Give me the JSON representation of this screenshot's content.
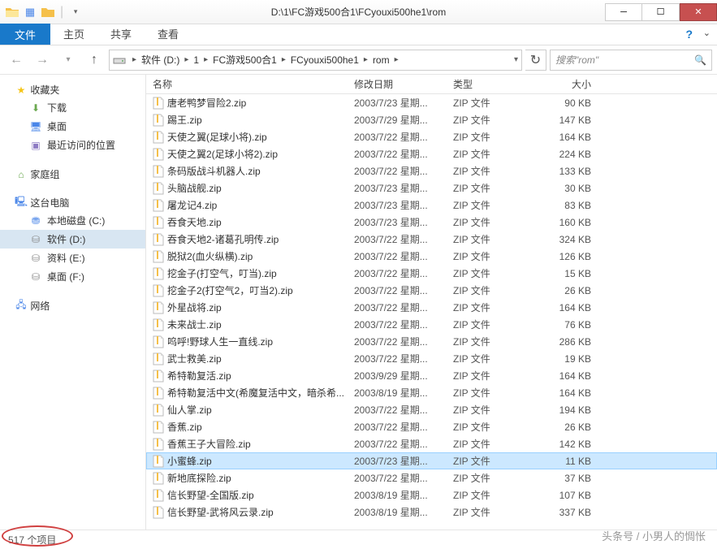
{
  "window": {
    "title": "D:\\1\\FC游戏500合1\\FCyouxi500he1\\rom"
  },
  "ribbon": {
    "file": "文件",
    "tabs": [
      "主页",
      "共享",
      "查看"
    ]
  },
  "breadcrumb": {
    "items": [
      "软件 (D:)",
      "1",
      "FC游戏500合1",
      "FCyouxi500he1",
      "rom"
    ]
  },
  "search": {
    "placeholder": "搜索\"rom\""
  },
  "sidebar": {
    "favorites": {
      "label": "收藏夹",
      "items": [
        "下载",
        "桌面",
        "最近访问的位置"
      ]
    },
    "homegroup": {
      "label": "家庭组"
    },
    "computer": {
      "label": "这台电脑",
      "items": [
        "本地磁盘 (C:)",
        "软件 (D:)",
        "资料 (E:)",
        "桌面 (F:)"
      ]
    },
    "network": {
      "label": "网络"
    }
  },
  "columns": {
    "name": "名称",
    "date": "修改日期",
    "type": "类型",
    "size": "大小"
  },
  "files": [
    {
      "name": "唐老鸭梦冒险2.zip",
      "date": "2003/7/23 星期...",
      "type": "ZIP 文件",
      "size": "90 KB"
    },
    {
      "name": "踢王.zip",
      "date": "2003/7/29 星期...",
      "type": "ZIP 文件",
      "size": "147 KB"
    },
    {
      "name": "天使之翼(足球小将).zip",
      "date": "2003/7/22 星期...",
      "type": "ZIP 文件",
      "size": "164 KB"
    },
    {
      "name": "天使之翼2(足球小将2).zip",
      "date": "2003/7/22 星期...",
      "type": "ZIP 文件",
      "size": "224 KB"
    },
    {
      "name": "条码版战斗机器人.zip",
      "date": "2003/7/22 星期...",
      "type": "ZIP 文件",
      "size": "133 KB"
    },
    {
      "name": "头脑战舰.zip",
      "date": "2003/7/23 星期...",
      "type": "ZIP 文件",
      "size": "30 KB"
    },
    {
      "name": "屠龙记4.zip",
      "date": "2003/7/23 星期...",
      "type": "ZIP 文件",
      "size": "83 KB"
    },
    {
      "name": "吞食天地.zip",
      "date": "2003/7/23 星期...",
      "type": "ZIP 文件",
      "size": "160 KB"
    },
    {
      "name": "吞食天地2-诸葛孔明传.zip",
      "date": "2003/7/22 星期...",
      "type": "ZIP 文件",
      "size": "324 KB"
    },
    {
      "name": "脱狱2(血火纵横).zip",
      "date": "2003/7/22 星期...",
      "type": "ZIP 文件",
      "size": "126 KB"
    },
    {
      "name": "挖金子(打空气，叮当).zip",
      "date": "2003/7/22 星期...",
      "type": "ZIP 文件",
      "size": "15 KB"
    },
    {
      "name": "挖金子2(打空气2，叮当2).zip",
      "date": "2003/7/22 星期...",
      "type": "ZIP 文件",
      "size": "26 KB"
    },
    {
      "name": "外星战将.zip",
      "date": "2003/7/22 星期...",
      "type": "ZIP 文件",
      "size": "164 KB"
    },
    {
      "name": "未来战士.zip",
      "date": "2003/7/22 星期...",
      "type": "ZIP 文件",
      "size": "76 KB"
    },
    {
      "name": "呜呼!野球人生一直线.zip",
      "date": "2003/7/22 星期...",
      "type": "ZIP 文件",
      "size": "286 KB"
    },
    {
      "name": "武士救美.zip",
      "date": "2003/7/22 星期...",
      "type": "ZIP 文件",
      "size": "19 KB"
    },
    {
      "name": "希特勒复活.zip",
      "date": "2003/9/29 星期...",
      "type": "ZIP 文件",
      "size": "164 KB"
    },
    {
      "name": "希特勒复活中文(希魔复活中文，暗杀希...",
      "date": "2003/8/19 星期...",
      "type": "ZIP 文件",
      "size": "164 KB"
    },
    {
      "name": "仙人掌.zip",
      "date": "2003/7/22 星期...",
      "type": "ZIP 文件",
      "size": "194 KB"
    },
    {
      "name": "香蕉.zip",
      "date": "2003/7/22 星期...",
      "type": "ZIP 文件",
      "size": "26 KB"
    },
    {
      "name": "香蕉王子大冒险.zip",
      "date": "2003/7/22 星期...",
      "type": "ZIP 文件",
      "size": "142 KB"
    },
    {
      "name": "小蜜蜂.zip",
      "date": "2003/7/23 星期...",
      "type": "ZIP 文件",
      "size": "11 KB",
      "selected": true
    },
    {
      "name": "新地底探险.zip",
      "date": "2003/7/22 星期...",
      "type": "ZIP 文件",
      "size": "37 KB"
    },
    {
      "name": "信长野望-全国版.zip",
      "date": "2003/8/19 星期...",
      "type": "ZIP 文件",
      "size": "107 KB"
    },
    {
      "name": "信长野望-武将风云录.zip",
      "date": "2003/8/19 星期...",
      "type": "ZIP 文件",
      "size": "337 KB"
    }
  ],
  "status": {
    "count": "517 个项目"
  },
  "watermark": "头条号 / 小男人的惆怅"
}
